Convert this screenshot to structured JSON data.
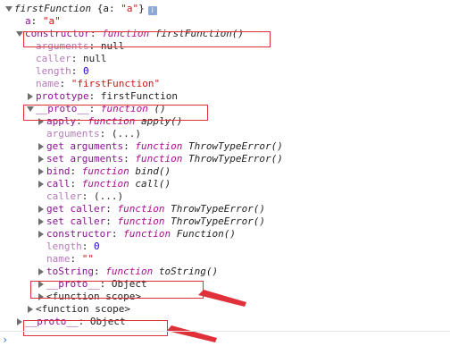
{
  "root": {
    "name": "firstFunction",
    "summary": "{a: \"a\"}",
    "info_icon": "i"
  },
  "rows": [
    {
      "indent": 0,
      "toggle": "open",
      "parts": [
        [
          "fn",
          "firstFunction "
        ],
        [
          "plain",
          "{a: "
        ],
        [
          "s",
          "\"a\""
        ],
        [
          "plain",
          "}"
        ]
      ],
      "root": true
    },
    {
      "indent": 1,
      "toggle": "none",
      "parts": [
        [
          "k",
          "a"
        ],
        [
          "p",
          ": "
        ],
        [
          "s",
          "\"a\""
        ]
      ]
    },
    {
      "indent": 1,
      "toggle": "open",
      "parts": [
        [
          "k",
          "constructor"
        ],
        [
          "p",
          ": "
        ],
        [
          "fk",
          "function "
        ],
        [
          "fn",
          "firstFunction()"
        ]
      ]
    },
    {
      "indent": 2,
      "toggle": "none",
      "parts": [
        [
          "kd",
          "arguments"
        ],
        [
          "p",
          ": null"
        ]
      ]
    },
    {
      "indent": 2,
      "toggle": "none",
      "parts": [
        [
          "kd",
          "caller"
        ],
        [
          "p",
          ": null"
        ]
      ]
    },
    {
      "indent": 2,
      "toggle": "none",
      "parts": [
        [
          "kd",
          "length"
        ],
        [
          "p",
          ": "
        ],
        [
          "n",
          "0"
        ]
      ]
    },
    {
      "indent": 2,
      "toggle": "none",
      "parts": [
        [
          "kd",
          "name"
        ],
        [
          "p",
          ": "
        ],
        [
          "s",
          "\"firstFunction\""
        ]
      ]
    },
    {
      "indent": 2,
      "toggle": "closed",
      "parts": [
        [
          "k",
          "prototype"
        ],
        [
          "p",
          ": firstFunction"
        ]
      ]
    },
    {
      "indent": 2,
      "toggle": "open",
      "parts": [
        [
          "k",
          "__proto__"
        ],
        [
          "p",
          ": "
        ],
        [
          "fk",
          "function "
        ],
        [
          "fn",
          "()"
        ]
      ]
    },
    {
      "indent": 3,
      "toggle": "closed",
      "parts": [
        [
          "k",
          "apply"
        ],
        [
          "p",
          ": "
        ],
        [
          "fk",
          "function "
        ],
        [
          "fn",
          "apply()"
        ]
      ]
    },
    {
      "indent": 3,
      "toggle": "none",
      "parts": [
        [
          "kd",
          "arguments"
        ],
        [
          "p",
          ": (...)"
        ]
      ]
    },
    {
      "indent": 3,
      "toggle": "closed",
      "parts": [
        [
          "k",
          "get arguments"
        ],
        [
          "p",
          ": "
        ],
        [
          "fk",
          "function "
        ],
        [
          "fn",
          "ThrowTypeError()"
        ]
      ]
    },
    {
      "indent": 3,
      "toggle": "closed",
      "parts": [
        [
          "k",
          "set arguments"
        ],
        [
          "p",
          ": "
        ],
        [
          "fk",
          "function "
        ],
        [
          "fn",
          "ThrowTypeError()"
        ]
      ]
    },
    {
      "indent": 3,
      "toggle": "closed",
      "parts": [
        [
          "k",
          "bind"
        ],
        [
          "p",
          ": "
        ],
        [
          "fk",
          "function "
        ],
        [
          "fn",
          "bind()"
        ]
      ]
    },
    {
      "indent": 3,
      "toggle": "closed",
      "parts": [
        [
          "k",
          "call"
        ],
        [
          "p",
          ": "
        ],
        [
          "fk",
          "function "
        ],
        [
          "fn",
          "call()"
        ]
      ]
    },
    {
      "indent": 3,
      "toggle": "none",
      "parts": [
        [
          "kd",
          "caller"
        ],
        [
          "p",
          ": (...)"
        ]
      ]
    },
    {
      "indent": 3,
      "toggle": "closed",
      "parts": [
        [
          "k",
          "get caller"
        ],
        [
          "p",
          ": "
        ],
        [
          "fk",
          "function "
        ],
        [
          "fn",
          "ThrowTypeError()"
        ]
      ]
    },
    {
      "indent": 3,
      "toggle": "closed",
      "parts": [
        [
          "k",
          "set caller"
        ],
        [
          "p",
          ": "
        ],
        [
          "fk",
          "function "
        ],
        [
          "fn",
          "ThrowTypeError()"
        ]
      ]
    },
    {
      "indent": 3,
      "toggle": "closed",
      "parts": [
        [
          "k",
          "constructor"
        ],
        [
          "p",
          ": "
        ],
        [
          "fk",
          "function "
        ],
        [
          "fn",
          "Function()"
        ]
      ]
    },
    {
      "indent": 3,
      "toggle": "none",
      "parts": [
        [
          "kd",
          "length"
        ],
        [
          "p",
          ": "
        ],
        [
          "n",
          "0"
        ]
      ]
    },
    {
      "indent": 3,
      "toggle": "none",
      "parts": [
        [
          "kd",
          "name"
        ],
        [
          "p",
          ": "
        ],
        [
          "s",
          "\"\""
        ]
      ]
    },
    {
      "indent": 3,
      "toggle": "closed",
      "parts": [
        [
          "k",
          "toString"
        ],
        [
          "p",
          ": "
        ],
        [
          "fk",
          "function "
        ],
        [
          "fn",
          "toString()"
        ]
      ]
    },
    {
      "indent": 3,
      "toggle": "closed",
      "parts": [
        [
          "k",
          "__proto__"
        ],
        [
          "p",
          ": Object"
        ]
      ]
    },
    {
      "indent": 3,
      "toggle": "closed",
      "parts": [
        [
          "p",
          "<function scope>"
        ]
      ]
    },
    {
      "indent": 2,
      "toggle": "closed",
      "parts": [
        [
          "p",
          "<function scope>"
        ]
      ]
    },
    {
      "indent": 1,
      "toggle": "closed",
      "parts": [
        [
          "k",
          "__proto__"
        ],
        [
          "p",
          ": Object"
        ]
      ]
    }
  ],
  "annotation_color": "#e0303a",
  "prompt_symbol": "›"
}
